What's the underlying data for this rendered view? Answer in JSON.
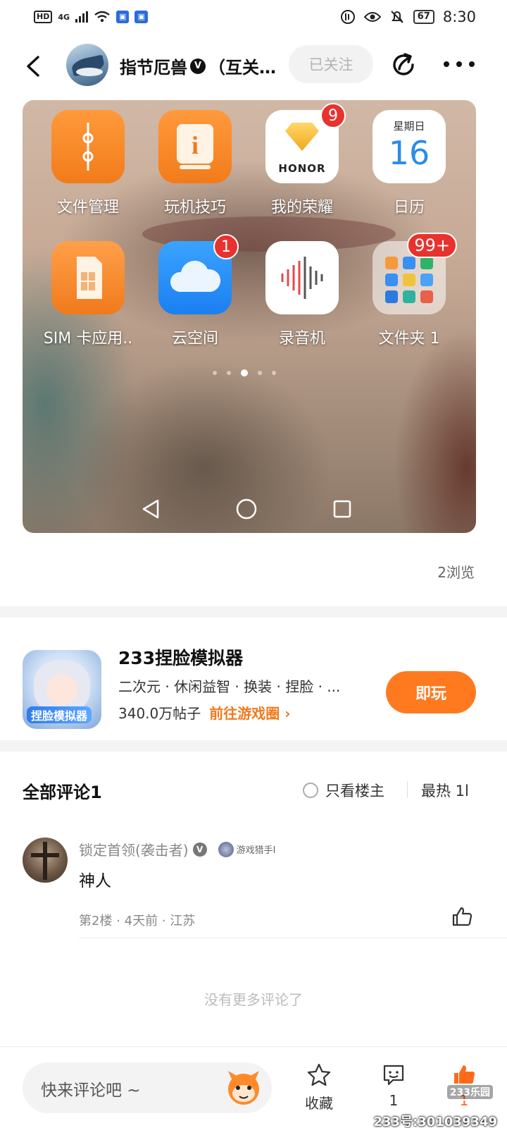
{
  "status_bar": {
    "left_icons": [
      "HD",
      "4G",
      "signal-icon",
      "wifi-icon",
      "notification-icon",
      "notification-icon"
    ],
    "network_label": "4G",
    "hd_label": "HD",
    "battery": "67",
    "time": "8:30"
  },
  "header": {
    "title": "指节厄兽",
    "verified_mark": "V",
    "title_suffix": "（互关…",
    "follow_label": "已关注"
  },
  "post_image": {
    "apps": [
      {
        "label": "文件管理",
        "icon": "folder-envelope-icon",
        "badge": ""
      },
      {
        "label": "玩机技巧",
        "icon": "info-icon",
        "badge": ""
      },
      {
        "label": "我的荣耀",
        "icon": "honor-icon",
        "badge": "9",
        "brand_text": "HONOR"
      },
      {
        "label": "日历",
        "icon": "calendar-icon",
        "badge": "",
        "weekday": "星期日",
        "day": "16"
      },
      {
        "label": "SIM 卡应用..",
        "icon": "sim-icon",
        "badge": ""
      },
      {
        "label": "云空间",
        "icon": "cloud-icon",
        "badge": "1"
      },
      {
        "label": "录音机",
        "icon": "recorder-icon",
        "badge": ""
      },
      {
        "label": "文件夹 1",
        "icon": "folder-icon",
        "badge": "99+"
      }
    ]
  },
  "views_label": "2浏览",
  "game": {
    "name": "233捏脸模拟器",
    "icon_text": "捏脸模拟器",
    "tags": "二次元 · 休闲益智 · 换装 · 捏脸 · ...",
    "posts": "340.0万帖子",
    "link_label": "前往游戏圈",
    "play_label": "即玩"
  },
  "comments": {
    "title": "全部评论1",
    "only_op_label": "只看楼主",
    "sort_label": "最热 1l",
    "items": [
      {
        "user": "锁定首领(袭击者)",
        "verified_mark": "V",
        "medal_label": "游戏猎手I",
        "text": "神人",
        "meta": "第2楼 · 4天前 · 江苏"
      }
    ],
    "no_more": "没有更多评论了"
  },
  "bottom_bar": {
    "input_placeholder": "快来评论吧 ~",
    "collect_label": "收藏",
    "comment_count": "1",
    "like_count": "1",
    "watermark": "233号:301039349",
    "watermark_logo": "233乐园"
  },
  "colors": {
    "accent": "#ff7a1f",
    "link": "#f07a1c",
    "badge_red": "#e8322e"
  }
}
